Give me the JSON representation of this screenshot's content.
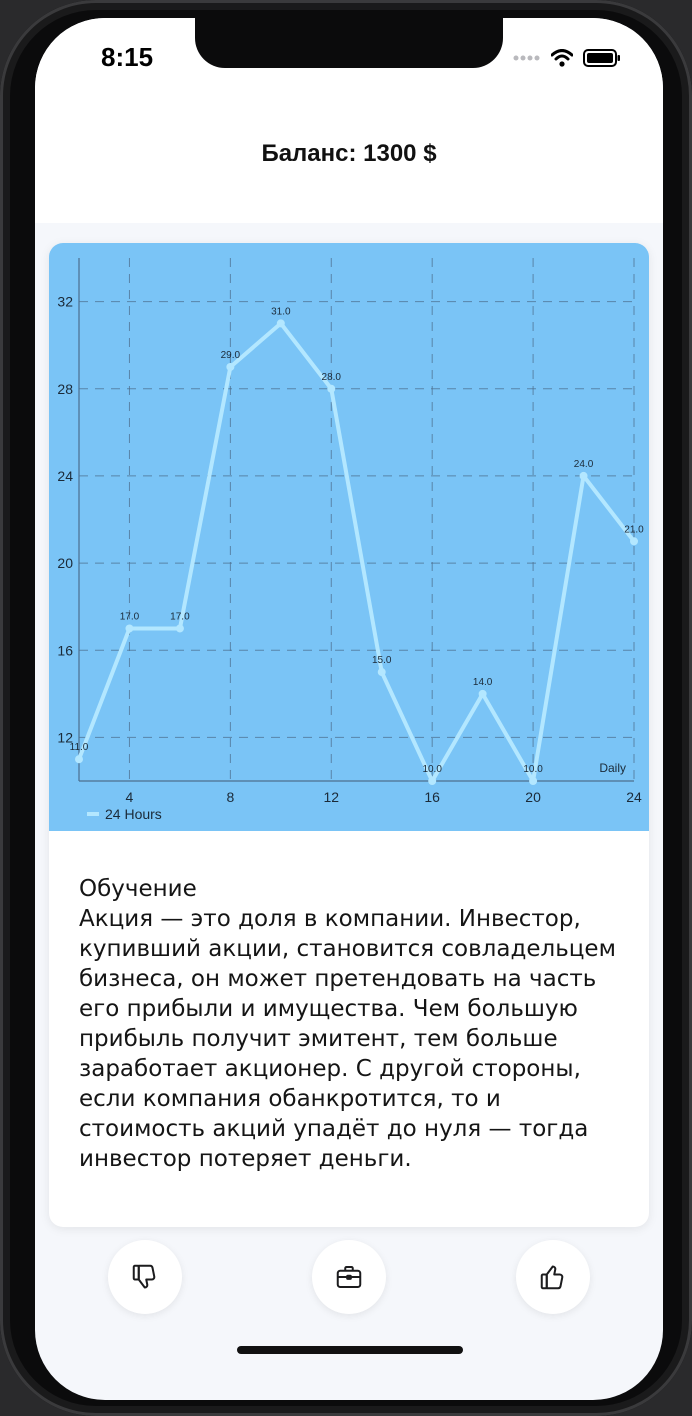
{
  "status_bar": {
    "time": "8:15"
  },
  "header": {
    "balance": "Баланс: 1300 $"
  },
  "chart_data": {
    "type": "line",
    "x": [
      2,
      4,
      6,
      8,
      10,
      12,
      14,
      16,
      18,
      20,
      22,
      24
    ],
    "series": [
      {
        "name": "24 Hours",
        "values": [
          11,
          17,
          17,
          29,
          31,
          28,
          15,
          10,
          14,
          10,
          24,
          21
        ]
      }
    ],
    "point_labels": [
      "11.0",
      "17.0",
      "17.0",
      "29.0",
      "31.0",
      "28.0",
      "15.0",
      "10.0",
      "14.0",
      "10.0",
      "24.0",
      "21.0"
    ],
    "x_ticks": [
      "4",
      "8",
      "12",
      "16",
      "20",
      "24"
    ],
    "y_ticks": [
      "12",
      "16",
      "20",
      "24",
      "28",
      "32"
    ],
    "x_tick_values": [
      4,
      8,
      12,
      16,
      20,
      24
    ],
    "y_tick_values": [
      12,
      16,
      20,
      24,
      28,
      32
    ],
    "xlim": [
      2,
      24
    ],
    "ylim": [
      10,
      34
    ],
    "xlabel": "Daily",
    "ylabel": "",
    "grid": true,
    "legend": "bottom-left",
    "colors": {
      "background": "#7ac4f6",
      "line": "#b3e7ff",
      "grid": "#4d6f8e",
      "text": "#1b2a38"
    }
  },
  "lesson": {
    "title": "Обучение",
    "body": "Акция — это доля в компании. Инвестор, купивший акции, становится совладельцем бизнеса, он может претендовать на часть его прибыли и имущества. Чем большую прибыль получит эмитент, тем больше заработает акционер. С другой стороны, если компания обанкротится, то и стоимость акций упадёт до нуля — тогда инвестор потеряет деньги."
  },
  "actions": [
    {
      "icon": "thumbs-down-icon"
    },
    {
      "icon": "briefcase-icon"
    },
    {
      "icon": "thumbs-up-icon"
    }
  ]
}
